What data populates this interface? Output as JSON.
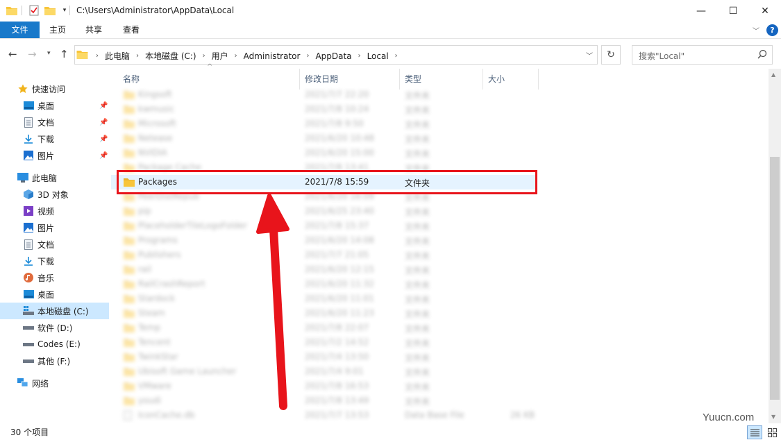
{
  "window": {
    "title": "C:\\Users\\Administrator\\AppData\\Local",
    "minimize": "—",
    "maximize": "☐",
    "close": "✕"
  },
  "ribbon": {
    "file": "文件",
    "home": "主页",
    "share": "共享",
    "view": "查看",
    "help": "?"
  },
  "address": {
    "crumbs": [
      "此电脑",
      "本地磁盘 (C:)",
      "用户",
      "Administrator",
      "AppData",
      "Local"
    ],
    "search_placeholder": "搜索\"Local\""
  },
  "nav": {
    "quick_access": "快速访问",
    "qa_desktop": "桌面",
    "qa_documents": "文档",
    "qa_downloads": "下载",
    "qa_pictures": "图片",
    "this_pc": "此电脑",
    "pc_3d": "3D 对象",
    "pc_videos": "视频",
    "pc_pictures": "图片",
    "pc_documents": "文档",
    "pc_downloads": "下载",
    "pc_music": "音乐",
    "pc_desktop": "桌面",
    "drive_c": "本地磁盘 (C:)",
    "drive_d": "软件 (D:)",
    "drive_e": "Codes (E:)",
    "drive_f": "其他 (F:)",
    "network": "网络"
  },
  "columns": {
    "name": "名称",
    "date": "修改日期",
    "type": "类型",
    "size": "大小"
  },
  "files": [
    {
      "name": "Kingsoft",
      "date": "2021/7/7 22:20",
      "type": "文件夹",
      "size": ""
    },
    {
      "name": "kwmusic",
      "date": "2021/7/8 10:24",
      "type": "文件夹",
      "size": ""
    },
    {
      "name": "Microsoft",
      "date": "2021/7/8 9:50",
      "type": "文件夹",
      "size": ""
    },
    {
      "name": "Netease",
      "date": "2021/6/20 10:48",
      "type": "文件夹",
      "size": ""
    },
    {
      "name": "NVIDIA",
      "date": "2021/6/20 15:00",
      "type": "文件夹",
      "size": ""
    },
    {
      "name": "Package Cache",
      "date": "2021/7/8 13:41",
      "type": "文件夹",
      "size": ""
    },
    {
      "name": "Packages",
      "date": "2021/7/8 15:59",
      "type": "文件夹",
      "size": ""
    },
    {
      "name": "PeerDistRepub",
      "date": "2021/6/20 16:09",
      "type": "文件夹",
      "size": ""
    },
    {
      "name": "pip",
      "date": "2021/6/25 23:40",
      "type": "文件夹",
      "size": ""
    },
    {
      "name": "PlaceholderTileLogoFolder",
      "date": "2021/7/8 15:37",
      "type": "文件夹",
      "size": ""
    },
    {
      "name": "Programs",
      "date": "2021/6/20 14:08",
      "type": "文件夹",
      "size": ""
    },
    {
      "name": "Publishers",
      "date": "2021/7/7 21:05",
      "type": "文件夹",
      "size": ""
    },
    {
      "name": "rail",
      "date": "2021/6/20 12:15",
      "type": "文件夹",
      "size": ""
    },
    {
      "name": "RailCrashReport",
      "date": "2021/6/20 11:32",
      "type": "文件夹",
      "size": ""
    },
    {
      "name": "Stardock",
      "date": "2021/6/20 11:01",
      "type": "文件夹",
      "size": ""
    },
    {
      "name": "Steam",
      "date": "2021/6/20 11:23",
      "type": "文件夹",
      "size": ""
    },
    {
      "name": "Temp",
      "date": "2021/7/8 22:07",
      "type": "文件夹",
      "size": ""
    },
    {
      "name": "Tencent",
      "date": "2021/7/2 14:52",
      "type": "文件夹",
      "size": ""
    },
    {
      "name": "TwinkStar",
      "date": "2021/7/4 13:50",
      "type": "文件夹",
      "size": ""
    },
    {
      "name": "Ubisoft Game Launcher",
      "date": "2021/7/4 9:01",
      "type": "文件夹",
      "size": ""
    },
    {
      "name": "VMware",
      "date": "2021/7/8 16:53",
      "type": "文件夹",
      "size": ""
    },
    {
      "name": "youdi",
      "date": "2021/7/8 13:49",
      "type": "文件夹",
      "size": ""
    },
    {
      "name": "IconCache.db",
      "date": "2021/7/7 13:53",
      "type": "Data Base File",
      "size": "26 KB"
    }
  ],
  "status": {
    "count": "30 个项目"
  },
  "watermark": "Yuucn.com",
  "colors": {
    "accent": "#1979ca",
    "highlight_box": "#e8141b",
    "selection": "#cce8ff",
    "folder": "#f8c53a"
  }
}
